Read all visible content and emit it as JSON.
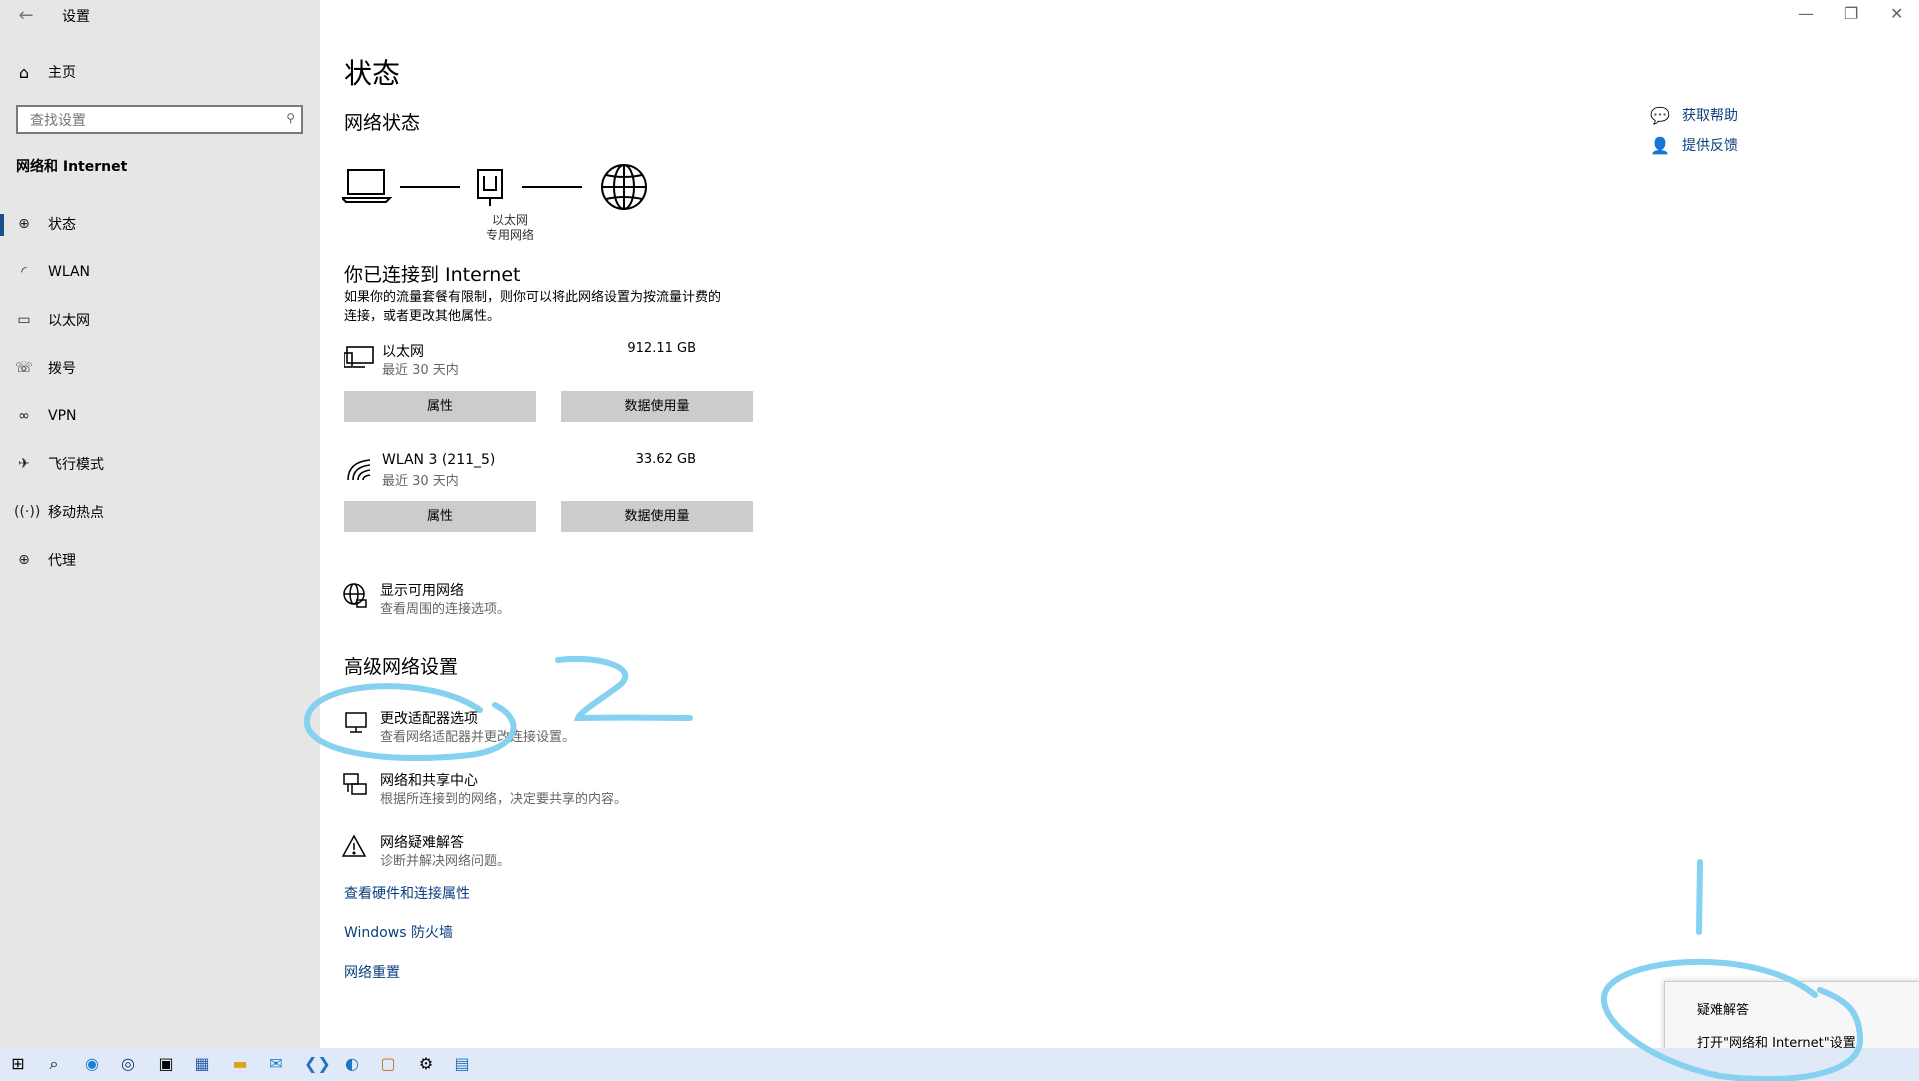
{
  "window": {
    "title": "设置",
    "back_icon": "back-arrow-icon",
    "minimize_icon": "minimize-icon",
    "restore_icon": "restore-icon",
    "close_icon": "close-icon"
  },
  "sidebar": {
    "home_label": "主页",
    "search_placeholder": "查找设置",
    "section_title": "网络和 Internet",
    "items": [
      {
        "label": "状态",
        "icon": "status-globe-icon",
        "active": true
      },
      {
        "label": "WLAN",
        "icon": "wifi-icon"
      },
      {
        "label": "以太网",
        "icon": "ethernet-icon"
      },
      {
        "label": "拨号",
        "icon": "dialup-icon"
      },
      {
        "label": "VPN",
        "icon": "vpn-icon"
      },
      {
        "label": "飞行模式",
        "icon": "airplane-icon"
      },
      {
        "label": "移动热点",
        "icon": "hotspot-icon"
      },
      {
        "label": "代理",
        "icon": "proxy-globe-icon"
      }
    ]
  },
  "main": {
    "title": "状态",
    "network_status_heading": "网络状态",
    "diagram": {
      "adapter_name": "以太网",
      "network_type": "专用网络"
    },
    "connected_title": "你已连接到 Internet",
    "connected_desc_line1": "如果你的流量套餐有限制，则你可以将此网络设置为按流量计费的",
    "connected_desc_line2": "连接，或者更改其他属性。",
    "connections": [
      {
        "name": "以太网",
        "period": "最近 30 天内",
        "usage": "912.11 GB",
        "btn_properties": "属性",
        "btn_data": "数据使用量"
      },
      {
        "name": "WLAN 3 (211_5)",
        "period": "最近 30 天内",
        "usage": "33.62 GB",
        "btn_properties": "属性",
        "btn_data": "数据使用量"
      }
    ],
    "show_networks": {
      "title": "显示可用网络",
      "desc": "查看周围的连接选项。"
    },
    "advanced_heading": "高级网络设置",
    "advanced_items": [
      {
        "title": "更改适配器选项",
        "desc": "查看网络适配器并更改连接设置。"
      },
      {
        "title": "网络和共享中心",
        "desc": "根据所连接到的网络，决定要共享的内容。"
      },
      {
        "title": "网络疑难解答",
        "desc": "诊断并解决网络问题。"
      }
    ],
    "links": [
      "查看硬件和连接属性",
      "Windows 防火墙",
      "网络重置"
    ]
  },
  "help": {
    "get_help": "获取帮助",
    "feedback": "提供反馈"
  },
  "context_menu": {
    "items": [
      "疑难解答",
      "打开\"网络和 Internet\"设置"
    ]
  },
  "annotations": {
    "label_1": "1",
    "label_2": "2",
    "color": "#86d0f0"
  },
  "taskbar": {
    "icons": [
      "windows-start-icon",
      "search-icon",
      "edge-icon",
      "steam-icon",
      "terminal-icon",
      "store-icon",
      "file-explorer-icon",
      "mail-icon",
      "vscode-icon",
      "app-icon",
      "window-app-icon",
      "settings-gear-icon",
      "remote-desktop-icon"
    ]
  }
}
